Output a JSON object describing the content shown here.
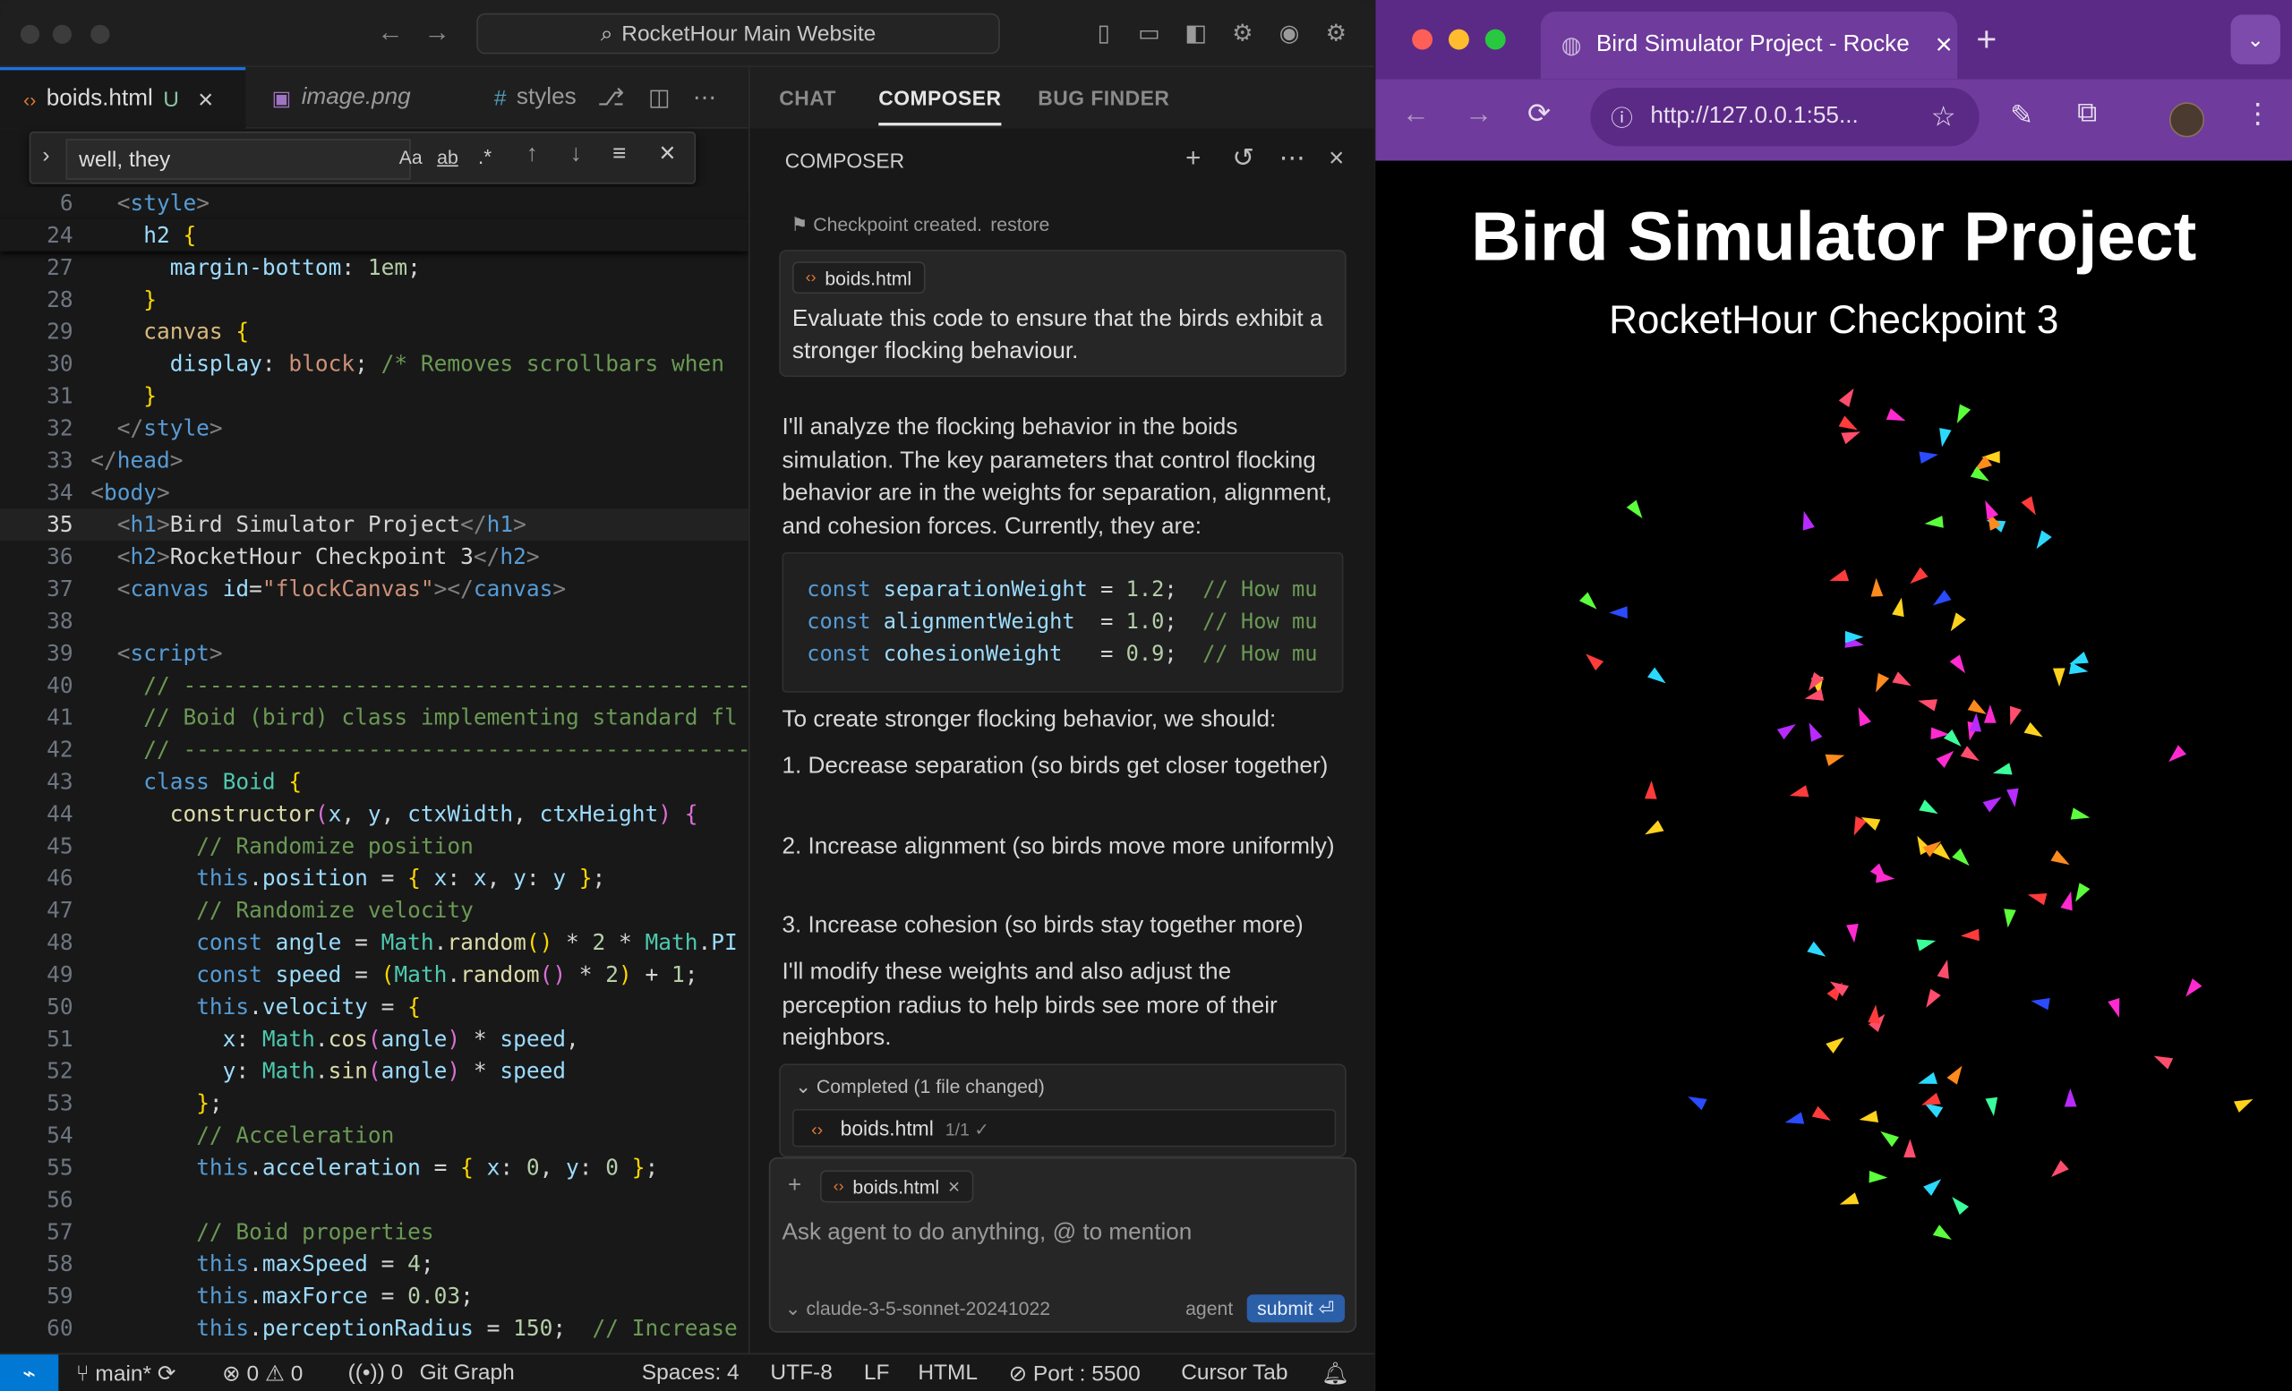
{
  "ide": {
    "search_title": "RocketHour Main Website",
    "tabs": [
      {
        "label": "boids.html",
        "badge": "U"
      },
      {
        "label": "image.png"
      },
      {
        "label": "styles"
      }
    ],
    "find": {
      "value": "well, they",
      "opt_case": "Aa",
      "opt_word": "ab",
      "opt_regex": ".*"
    },
    "code_lines": [
      {
        "n": "6",
        "sticky": true,
        "html": "  <span class='ang'>&lt;</span><span class='tg'>style</span><span class='ang'>&gt;</span>"
      },
      {
        "n": "24",
        "sticky": true,
        "html": "    <span class='prop'>h2</span> <span class='br'>{</span>"
      },
      {
        "n": "27",
        "html": "      <span class='prop'>margin-bottom</span>: <span class='num'>1em</span>;"
      },
      {
        "n": "28",
        "html": "    <span class='br'>}</span>"
      },
      {
        "n": "29",
        "html": "    <span class='prop' style='color:#d7ba7d'>canvas</span> <span class='br'>{</span>"
      },
      {
        "n": "30",
        "html": "      <span class='prop'>display</span>: <span class='str'>block</span>; <span class='cm'>/* Removes scrollbars when</span>"
      },
      {
        "n": "31",
        "html": "    <span class='br'>}</span>"
      },
      {
        "n": "32",
        "html": "  <span class='ang'>&lt;/</span><span class='tg'>style</span><span class='ang'>&gt;</span>"
      },
      {
        "n": "33",
        "html": "<span class='ang'>&lt;/</span><span class='tg'>head</span><span class='ang'>&gt;</span>"
      },
      {
        "n": "34",
        "html": "<span class='ang'>&lt;</span><span class='tg'>body</span><span class='ang'>&gt;</span>"
      },
      {
        "n": "35",
        "cur": true,
        "html": "  <span class='ang'>&lt;</span><span class='tg'>h1</span><span class='ang'>&gt;</span>Bird Simulator Project<span class='ang'>&lt;/</span><span class='tg'>h1</span><span class='ang'>&gt;</span>"
      },
      {
        "n": "36",
        "html": "  <span class='ang'>&lt;</span><span class='tg'>h2</span><span class='ang'>&gt;</span>RocketHour Checkpoint 3<span class='ang'>&lt;/</span><span class='tg'>h2</span><span class='ang'>&gt;</span>"
      },
      {
        "n": "37",
        "html": "  <span class='ang'>&lt;</span><span class='tg'>canvas</span> <span class='attr'>id</span>=<span class='str'>\"flockCanvas\"</span><span class='ang'>&gt;&lt;/</span><span class='tg'>canvas</span><span class='ang'>&gt;</span>"
      },
      {
        "n": "38",
        "html": ""
      },
      {
        "n": "39",
        "html": "  <span class='ang'>&lt;</span><span class='tg'>script</span><span class='ang'>&gt;</span>"
      },
      {
        "n": "40",
        "html": "    <span class='cm'>// ------------------------------------------------</span>"
      },
      {
        "n": "41",
        "html": "    <span class='cm'>// Boid (bird) class implementing standard fl</span>"
      },
      {
        "n": "42",
        "html": "    <span class='cm'>// ------------------------------------------------</span>"
      },
      {
        "n": "43",
        "html": "    <span class='kw'>class</span> <span class='cls'>Boid</span> <span class='br'>{</span>"
      },
      {
        "n": "44",
        "html": "      <span class='fn'>constructor</span><span class='br2'>(</span><span class='prop'>x</span>, <span class='prop'>y</span>, <span class='prop'>ctxWidth</span>, <span class='prop'>ctxHeight</span><span class='br2'>)</span> <span class='br2'>{</span>"
      },
      {
        "n": "45",
        "html": "        <span class='cm'>// Randomize position</span>"
      },
      {
        "n": "46",
        "html": "        <span class='kw'>this</span>.<span class='prop'>position</span> = <span class='br'>{</span> <span class='prop'>x</span>: <span class='prop'>x</span>, <span class='prop'>y</span>: <span class='prop'>y</span> <span class='br'>}</span>;"
      },
      {
        "n": "47",
        "html": "        <span class='cm'>// Randomize velocity</span>"
      },
      {
        "n": "48",
        "html": "        <span class='kw'>const</span> <span class='prop'>angle</span> = <span class='cls'>Math</span>.<span class='fn'>random</span><span class='br'>()</span> * <span class='num'>2</span> * <span class='cls'>Math</span>.<span class='prop'>PI</span>"
      },
      {
        "n": "49",
        "html": "        <span class='kw'>const</span> <span class='prop'>speed</span> = <span class='br'>(</span><span class='cls'>Math</span>.<span class='fn'>random</span><span class='br2'>()</span> * <span class='num'>2</span><span class='br'>)</span> + <span class='num'>1</span>;"
      },
      {
        "n": "50",
        "html": "        <span class='kw'>this</span>.<span class='prop'>velocity</span> = <span class='br'>{</span>"
      },
      {
        "n": "51",
        "html": "          <span class='prop'>x</span>: <span class='cls'>Math</span>.<span class='fn'>cos</span><span class='br2'>(</span><span class='prop'>angle</span><span class='br2'>)</span> * <span class='prop'>speed</span>,"
      },
      {
        "n": "52",
        "html": "          <span class='prop'>y</span>: <span class='cls'>Math</span>.<span class='fn'>sin</span><span class='br2'>(</span><span class='prop'>angle</span><span class='br2'>)</span> * <span class='prop'>speed</span>"
      },
      {
        "n": "53",
        "html": "        <span class='br'>}</span>;"
      },
      {
        "n": "54",
        "html": "        <span class='cm'>// Acceleration</span>"
      },
      {
        "n": "55",
        "html": "        <span class='kw'>this</span>.<span class='prop'>acceleration</span> = <span class='br'>{</span> <span class='prop'>x</span>: <span class='num'>0</span>, <span class='prop'>y</span>: <span class='num'>0</span> <span class='br'>}</span>;"
      },
      {
        "n": "56",
        "html": ""
      },
      {
        "n": "57",
        "html": "        <span class='cm'>// Boid properties</span>"
      },
      {
        "n": "58",
        "html": "        <span class='kw'>this</span>.<span class='prop'>maxSpeed</span> = <span class='num'>4</span>;"
      },
      {
        "n": "59",
        "html": "        <span class='kw'>this</span>.<span class='prop'>maxForce</span> = <span class='num'>0.03</span>;"
      },
      {
        "n": "60",
        "html": "        <span class='kw'>this</span>.<span class='prop'>perceptionRadius</span> = <span class='num'>150</span>;  <span class='cm'>// Increase</span>"
      }
    ],
    "status": {
      "branch": "main*",
      "errors": "0",
      "warnings": "0",
      "ports": "0",
      "git_graph": "Git Graph",
      "spaces": "Spaces: 4",
      "encoding": "UTF-8",
      "eol": "LF",
      "language": "HTML",
      "port": "Port : 5500",
      "cursor_tab": "Cursor Tab"
    }
  },
  "composer": {
    "tabs": [
      "CHAT",
      "COMPOSER",
      "BUG FINDER"
    ],
    "header": "COMPOSER",
    "checkpoint": "Checkpoint created.",
    "restore": "restore",
    "user_file": "boids.html",
    "user_message": "Evaluate this code to ensure that the birds exhibit a stronger flocking behaviour.",
    "resp_intro": "I'll analyze the flocking behavior in the boids simulation. The key parameters that control flocking behavior are in the weights for separation, alignment, and cohesion forces. Currently, they are:",
    "code": [
      {
        "kw": "const",
        "name": "separationWeight",
        "pad": " = ",
        "val": "1.2",
        "cm": "// How mu"
      },
      {
        "kw": "const",
        "name": "alignmentWeight",
        "pad": "  = ",
        "val": "1.0",
        "cm": "// How mu"
      },
      {
        "kw": "const",
        "name": "cohesionWeight",
        "pad": "   = ",
        "val": "0.9",
        "cm": "// How mu"
      }
    ],
    "resp_lead": "To create stronger flocking behavior, we should:",
    "steps": [
      "1. Decrease separation (so birds get closer together)",
      "2. Increase alignment (so birds move more uniformly)",
      "3. Increase cohesion (so birds stay together more)"
    ],
    "resp_outro": "I'll modify these weights and also adjust the perception radius to help birds see more of their neighbors.",
    "completed": "Completed",
    "changed": "(1 file changed)",
    "changed_file": "boids.html",
    "changed_count": "1/1 ✓",
    "input_file": "boids.html",
    "placeholder": "Ask agent to do anything, @ to mention",
    "model": "claude-3-5-sonnet-20241022",
    "mode": "agent",
    "submit": "submit ⏎"
  },
  "browser": {
    "tab_title": "Bird Simulator Project - Rocke",
    "url": "http://127.0.0.1:55...",
    "h1": "Bird Simulator Project",
    "h2": "RocketHour Checkpoint 3"
  },
  "colors": {
    "accent": "#1a73e8",
    "browser_frame": "#5b2a86",
    "browser_toolbar": "#6f3b9c",
    "submit": "#2b5fa8"
  }
}
